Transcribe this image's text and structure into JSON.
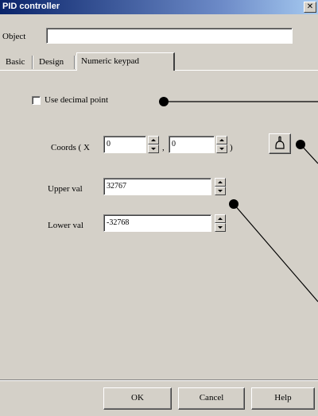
{
  "window": {
    "title": "PID controller",
    "close_glyph": "✕"
  },
  "object_field": {
    "label": "Object",
    "value": ""
  },
  "tabs": [
    {
      "label": "Basic"
    },
    {
      "label": "Design"
    },
    {
      "label": "Numeric keypad",
      "active": true
    }
  ],
  "numeric_keypad": {
    "use_decimal_point": {
      "label": "Use decimal point",
      "checked": false
    },
    "coords": {
      "label": "Coords ( X",
      "x_value": "0",
      "separator": ",",
      "y_value": "0",
      "close": ")"
    },
    "upper_val": {
      "label": "Upper val",
      "value": "32767"
    },
    "lower_val": {
      "label": "Lower val",
      "value": "-32768"
    }
  },
  "footer": {
    "ok_label": "OK",
    "cancel_label": "Cancel",
    "help_label": "Help"
  },
  "icons": {
    "picker": "pointer-hand-icon"
  }
}
